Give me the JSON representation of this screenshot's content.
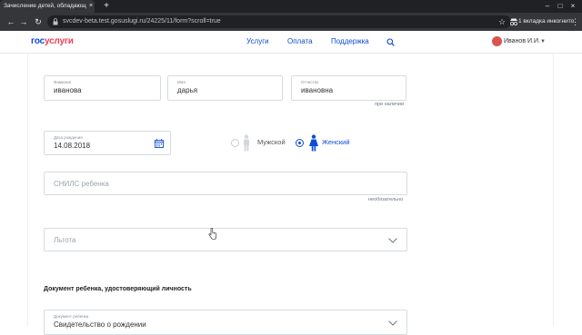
{
  "browser": {
    "tab_title": "Зачисление детей, обладающ",
    "tab_close": "×",
    "new_tab": "+",
    "url": "svcdev-beta.test.gosuslugi.ru/24225/11/form?scroll=true",
    "incognito_label": "1 вкладка инкогнито",
    "window_controls": [
      "–",
      "□",
      "×"
    ]
  },
  "header": {
    "logo_part1": "гос",
    "logo_part2": "услуги",
    "nav": [
      "Услуги",
      "Оплата",
      "Поддержка"
    ],
    "user_name": "Иванов И.И.",
    "accent_color": "#0d4cd3",
    "brand_red": "#ee3f58"
  },
  "form": {
    "surname": {
      "label": "Фамилия",
      "value": "иванова"
    },
    "name": {
      "label": "Имя",
      "value": "дарья"
    },
    "patronymic": {
      "label": "Отчество",
      "value": "ивановна",
      "hint": "при наличии"
    },
    "birthdate": {
      "label": "Дата рождения",
      "value": "14.08.2018"
    },
    "gender": {
      "options": [
        "Мужской",
        "Женский"
      ],
      "selected": "Женский"
    },
    "snils": {
      "placeholder": "СНИЛС ребенка",
      "hint": "необязательно"
    },
    "benefit": {
      "placeholder": "Льгота"
    },
    "document_section_title": "Документ ребенка, удостоверяющий личность",
    "document_type": {
      "label": "Документ ребенка",
      "value": "Свидетельство о рождении"
    }
  }
}
